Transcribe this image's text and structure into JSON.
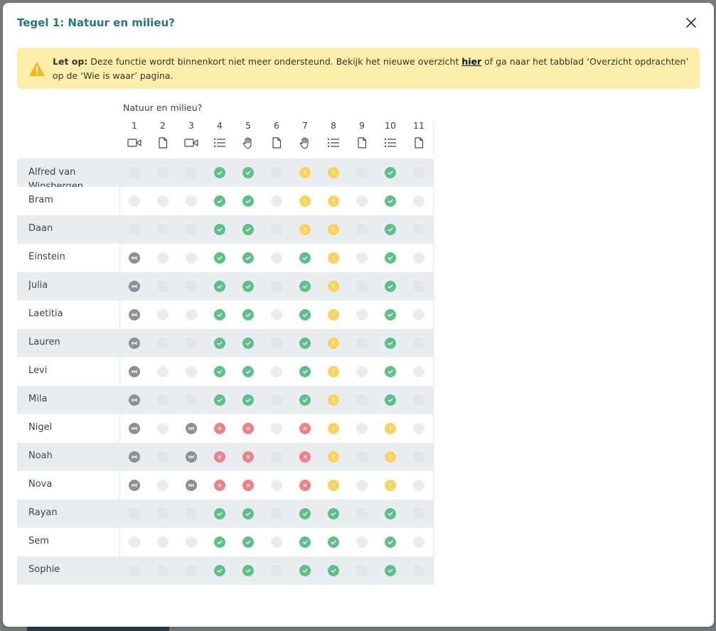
{
  "modal": {
    "title": "Tegel 1: Natuur en milieu?",
    "close_icon": "close-icon"
  },
  "alert": {
    "icon": "warning-icon",
    "bold_prefix": "Let op:",
    "text_before_link": " Deze functie wordt binnenkort niet meer ondersteund. Bekijk het nieuwe overzicht ",
    "link_text": "hier",
    "text_after_link": " of ga naar het tabblad ‘Overzicht opdrachten’ op de ‘Wie is waar’ pagina."
  },
  "grid": {
    "group_label": "Natuur en milieu?",
    "columns": [
      {
        "num": "1",
        "icon": "video-icon"
      },
      {
        "num": "2",
        "icon": "document-icon"
      },
      {
        "num": "3",
        "icon": "video-icon"
      },
      {
        "num": "4",
        "icon": "list-icon"
      },
      {
        "num": "5",
        "icon": "hand-icon"
      },
      {
        "num": "6",
        "icon": "document-icon"
      },
      {
        "num": "7",
        "icon": "hand-icon"
      },
      {
        "num": "8",
        "icon": "list-icon"
      },
      {
        "num": "9",
        "icon": "document-icon"
      },
      {
        "num": "10",
        "icon": "list-icon"
      },
      {
        "num": "11",
        "icon": "document-icon"
      }
    ],
    "colors": {
      "done": "#5ec089",
      "warn": "#fbd35c",
      "fail": "#f27f85",
      "skip": "#8a9096",
      "empty": "#eaedf0"
    },
    "rows": [
      {
        "name": "Alfred van Winsbergen",
        "statuses": [
          "empty",
          "empty",
          "empty",
          "done",
          "done",
          "empty",
          "warn",
          "warn",
          "empty",
          "done",
          "empty"
        ]
      },
      {
        "name": "Bram",
        "statuses": [
          "empty",
          "empty",
          "empty",
          "done",
          "done",
          "empty",
          "warn",
          "warn",
          "empty",
          "done",
          "empty"
        ]
      },
      {
        "name": "Daan",
        "statuses": [
          "empty",
          "empty",
          "empty",
          "done",
          "done",
          "empty",
          "warn",
          "warn",
          "empty",
          "done",
          "empty"
        ]
      },
      {
        "name": "Einstein",
        "statuses": [
          "skip",
          "empty",
          "empty",
          "done",
          "done",
          "empty",
          "done",
          "warn",
          "empty",
          "done",
          "empty"
        ]
      },
      {
        "name": "Julia",
        "statuses": [
          "skip",
          "empty",
          "empty",
          "done",
          "done",
          "empty",
          "done",
          "warn",
          "empty",
          "done",
          "empty"
        ]
      },
      {
        "name": "Laetitia",
        "statuses": [
          "skip",
          "empty",
          "empty",
          "done",
          "done",
          "empty",
          "done",
          "warn",
          "empty",
          "done",
          "empty"
        ]
      },
      {
        "name": "Lauren",
        "statuses": [
          "skip",
          "empty",
          "empty",
          "done",
          "done",
          "empty",
          "done",
          "warn",
          "empty",
          "done",
          "empty"
        ]
      },
      {
        "name": "Levi",
        "statuses": [
          "skip",
          "empty",
          "empty",
          "done",
          "done",
          "empty",
          "done",
          "warn",
          "empty",
          "done",
          "empty"
        ]
      },
      {
        "name": "Mila",
        "statuses": [
          "skip",
          "empty",
          "empty",
          "done",
          "done",
          "empty",
          "done",
          "warn",
          "empty",
          "done",
          "empty"
        ]
      },
      {
        "name": "Nigel",
        "statuses": [
          "skip",
          "empty",
          "skip",
          "fail",
          "fail",
          "empty",
          "fail",
          "warn",
          "empty",
          "warn",
          "empty"
        ]
      },
      {
        "name": "Noah",
        "statuses": [
          "skip",
          "empty",
          "skip",
          "fail",
          "fail",
          "empty",
          "fail",
          "warn",
          "empty",
          "warn",
          "empty"
        ]
      },
      {
        "name": "Nova",
        "statuses": [
          "skip",
          "empty",
          "skip",
          "fail",
          "fail",
          "empty",
          "fail",
          "warn",
          "empty",
          "warn",
          "empty"
        ]
      },
      {
        "name": "Rayan",
        "statuses": [
          "empty",
          "empty",
          "empty",
          "done",
          "done",
          "empty",
          "done",
          "done",
          "empty",
          "done",
          "empty"
        ]
      },
      {
        "name": "Sem",
        "statuses": [
          "empty",
          "empty",
          "empty",
          "done",
          "done",
          "empty",
          "done",
          "done",
          "empty",
          "done",
          "empty"
        ]
      },
      {
        "name": "Sophie",
        "statuses": [
          "empty",
          "empty",
          "empty",
          "done",
          "done",
          "empty",
          "done",
          "done",
          "empty",
          "done",
          "empty"
        ]
      }
    ]
  }
}
